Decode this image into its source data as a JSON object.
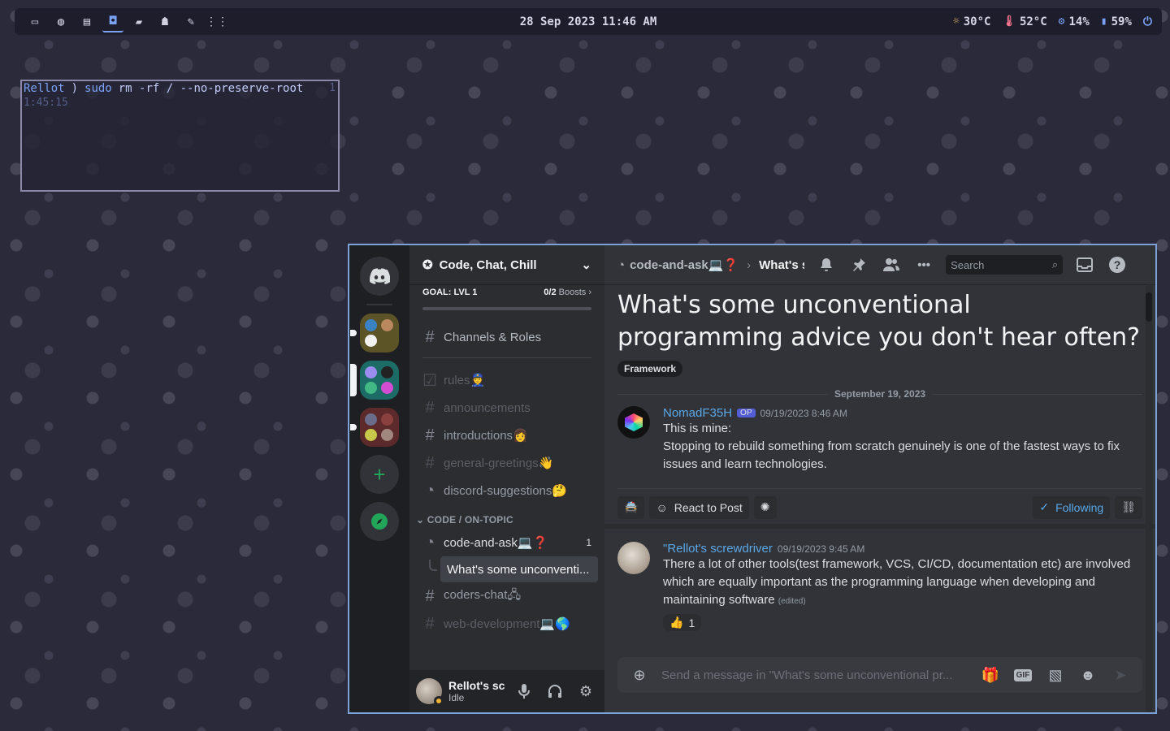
{
  "topbar": {
    "workspaces": [
      {
        "icon": "terminal-icon",
        "glyph": "▭"
      },
      {
        "icon": "firefox-icon",
        "glyph": "◍"
      },
      {
        "icon": "document-icon",
        "glyph": "▤"
      },
      {
        "icon": "discord-icon",
        "glyph": "◘",
        "active": true
      },
      {
        "icon": "folder-icon",
        "glyph": "▰"
      },
      {
        "icon": "ghost-icon",
        "glyph": "☗"
      },
      {
        "icon": "brush-icon",
        "glyph": "✎"
      },
      {
        "icon": "grid-icon",
        "glyph": "⋮⋮"
      }
    ],
    "clock": "28 Sep 2023 11:46 AM",
    "weather": "30°C",
    "temp": "52°C",
    "cpu": "14%",
    "battery": "59%"
  },
  "terminal": {
    "user": "Rellot",
    "arrow": ")",
    "cmd": "sudo",
    "args": "rm -rf / --no-preserve-root",
    "time": "1:45:15",
    "line_no": "1"
  },
  "discord": {
    "server": {
      "name": "Code, Chat, Chill",
      "goal": "GOAL: LVL 1",
      "boosts_count": "0/2",
      "boosts_label": "Boosts",
      "boost_progress": 0
    },
    "channels_roles": "Channels & Roles",
    "channels": [
      {
        "name": "rules👮",
        "kind": "rules",
        "muted": true
      },
      {
        "name": "announcements",
        "kind": "text",
        "muted": true
      },
      {
        "name": "introductions👩",
        "kind": "text",
        "muted": false
      },
      {
        "name": "general-greetings👋",
        "kind": "text",
        "muted": true
      },
      {
        "name": "discord-suggestions🤔",
        "kind": "forum",
        "muted": false
      }
    ],
    "category": "CODE / ON-TOPIC",
    "forum_channel": {
      "name": "code-and-ask💻❓",
      "unread": "1"
    },
    "thread": "What's some unconventi...",
    "more_channels": [
      {
        "name": "coders-chat🖧",
        "kind": "text",
        "muted": false
      },
      {
        "name": "web-development💻🌎",
        "kind": "text",
        "muted": true
      }
    ],
    "user": {
      "name": "Rellot's sc...",
      "status": "Idle"
    },
    "header": {
      "channel": "code-and-ask💻❓",
      "thread_short": "What's s",
      "search_placeholder": "Search"
    },
    "post": {
      "title": "What's some unconventional programming advice you don't hear often?",
      "tag": "Framework",
      "date": "September 19, 2023"
    },
    "messages": [
      {
        "author": "NomadF35H",
        "badge": "OP",
        "time": "09/19/2023 8:46 AM",
        "lines": [
          "This is mine:",
          "Stopping to rebuild something from scratch genuinely is one of the fastest ways to fix issues and learn technologies."
        ]
      },
      {
        "author": "\"Rellot's screwdriver",
        "time": "09/19/2023 9:45 AM",
        "text": "There a lot of other tools(test framework, VCS, CI/CD, documentation etc) are involved which are equally important as the programming language when developing and maintaining software",
        "edited": "(edited)",
        "reaction": {
          "emoji": "👍",
          "count": "1"
        }
      }
    ],
    "actions": {
      "react": "React to Post",
      "following": "Following"
    },
    "composer_placeholder": "Send a message in \"What's some unconventional pr...",
    "accent": "#5aa8e8",
    "idle_color": "#f0b232"
  }
}
